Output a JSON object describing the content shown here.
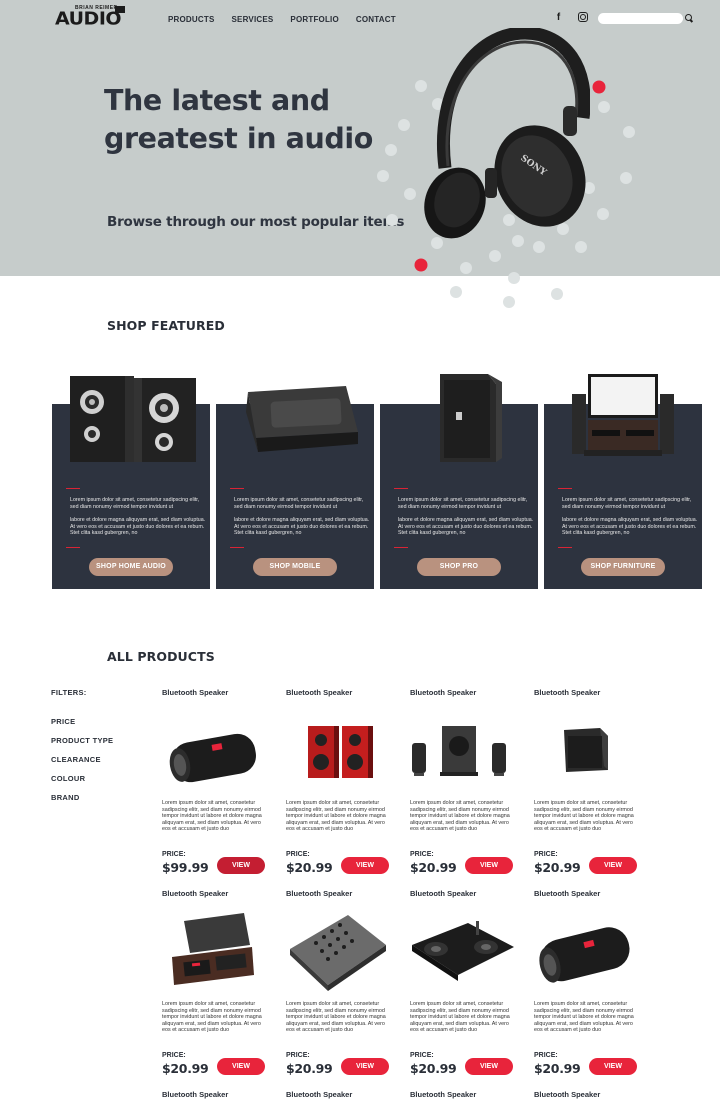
{
  "header": {
    "logo_small": "BRIAN REIMER",
    "logo_big": "AUDIO",
    "nav": [
      "PRODUCTS",
      "SERVICES",
      "PORTFOLIO",
      "CONTACT"
    ],
    "search_placeholder": ""
  },
  "hero": {
    "title_line1": "The latest and",
    "title_line2": "greatest in audio",
    "subtitle": "Browse through our most popular items",
    "headphone_brand": "SONY"
  },
  "featured": {
    "title": "SHOP FEATURED",
    "text1": "Lorem ipsum dolor sit amet, consetetur sadipscing elitr, sed diam nonumy eirmod tempor invidunt ut",
    "text2": "labore et dolore magna aliquyam erat, sed diam voluptua. At vero eos et accusam et justo duo dolores et ea rebum. Stet clita kasd gubergren, no",
    "cards": [
      {
        "button": "SHOP HOME AUDIO"
      },
      {
        "button": "SHOP MOBILE"
      },
      {
        "button": "SHOP PRO"
      },
      {
        "button": "SHOP FURNITURE"
      }
    ]
  },
  "products": {
    "title": "ALL PRODUCTS",
    "filters_title": "FILTERS:",
    "filters": [
      "PRICE",
      "PRODUCT TYPE",
      "CLEARANCE",
      "COLOUR",
      "BRAND"
    ],
    "description": "Lorem ipsum dolor sit amet, consetetur sadipscing elitr, sed diam nonumy eirmod tempor invidunt ut labore et dolore magna aliquyam erat, sed diam voluptua. At vero eos et accusam et justo duo",
    "price_label": "PRICE:",
    "view_label": "VIEW",
    "items": [
      {
        "name": "Bluetooth Speaker",
        "price": "$99.99"
      },
      {
        "name": "Bluetooth Speaker",
        "price": "$20.99"
      },
      {
        "name": "Bluetooth Speaker",
        "price": "$20.99"
      },
      {
        "name": "Bluetooth Speaker",
        "price": "$20.99"
      },
      {
        "name": "Bluetooth Speaker",
        "price": "$20.99"
      },
      {
        "name": "Bluetooth Speaker",
        "price": "$20.99"
      },
      {
        "name": "Bluetooth Speaker",
        "price": "$20.99"
      },
      {
        "name": "Bluetooth Speaker",
        "price": "$20.99"
      }
    ],
    "next_row_names": [
      "Bluetooth Speaker",
      "Bluetooth Speaker",
      "Bluetooth Speaker",
      "Bluetooth Speaker"
    ]
  },
  "colors": {
    "hero_bg": "#c6cccb",
    "card_bg": "#2d333f",
    "accent_red": "#e8243b",
    "featured_button": "#b9927f"
  }
}
